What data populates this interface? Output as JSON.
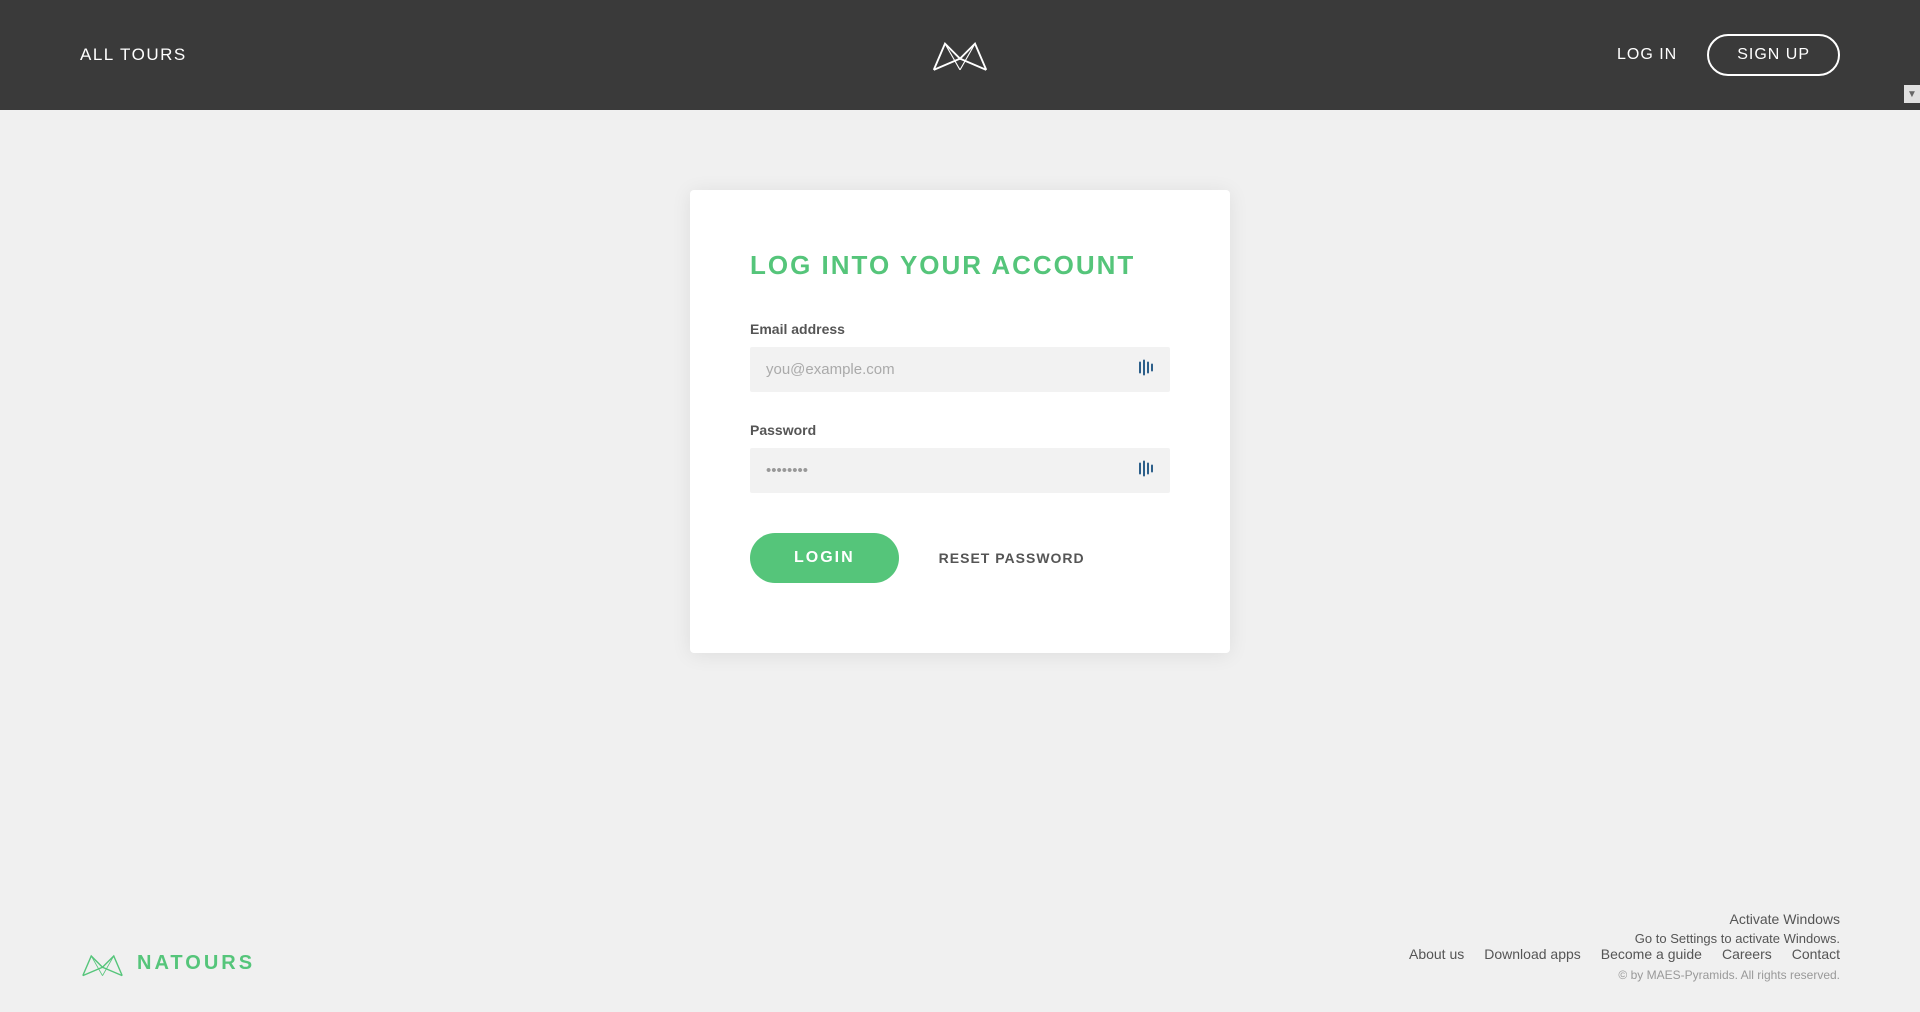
{
  "header": {
    "all_tours_label": "ALL TOURS",
    "login_label": "LOG IN",
    "signup_label": "SIGN UP",
    "logo_alt": "Natours Logo"
  },
  "login_card": {
    "title": "LOG INTO YOUR ACCOUNT",
    "email_label": "Email address",
    "email_placeholder": "you@example.com",
    "password_label": "Password",
    "password_placeholder": "••••••••",
    "login_button": "LOGIN",
    "reset_password_label": "RESET PASSWORD"
  },
  "footer": {
    "brand_name": "NATOURS",
    "links": [
      {
        "label": "About us"
      },
      {
        "label": "Download apps"
      },
      {
        "label": "Become a guide"
      },
      {
        "label": "Careers"
      },
      {
        "label": "Contact"
      }
    ],
    "copyright": "© by MAES-Pyramids. All rights reserved."
  },
  "windows": {
    "activate_title": "Activate Windows",
    "activate_sub": "Go to Settings to activate Windows."
  },
  "colors": {
    "green": "#55c57a",
    "dark_header": "#3a3a3a",
    "bg": "#f0f0f0"
  }
}
